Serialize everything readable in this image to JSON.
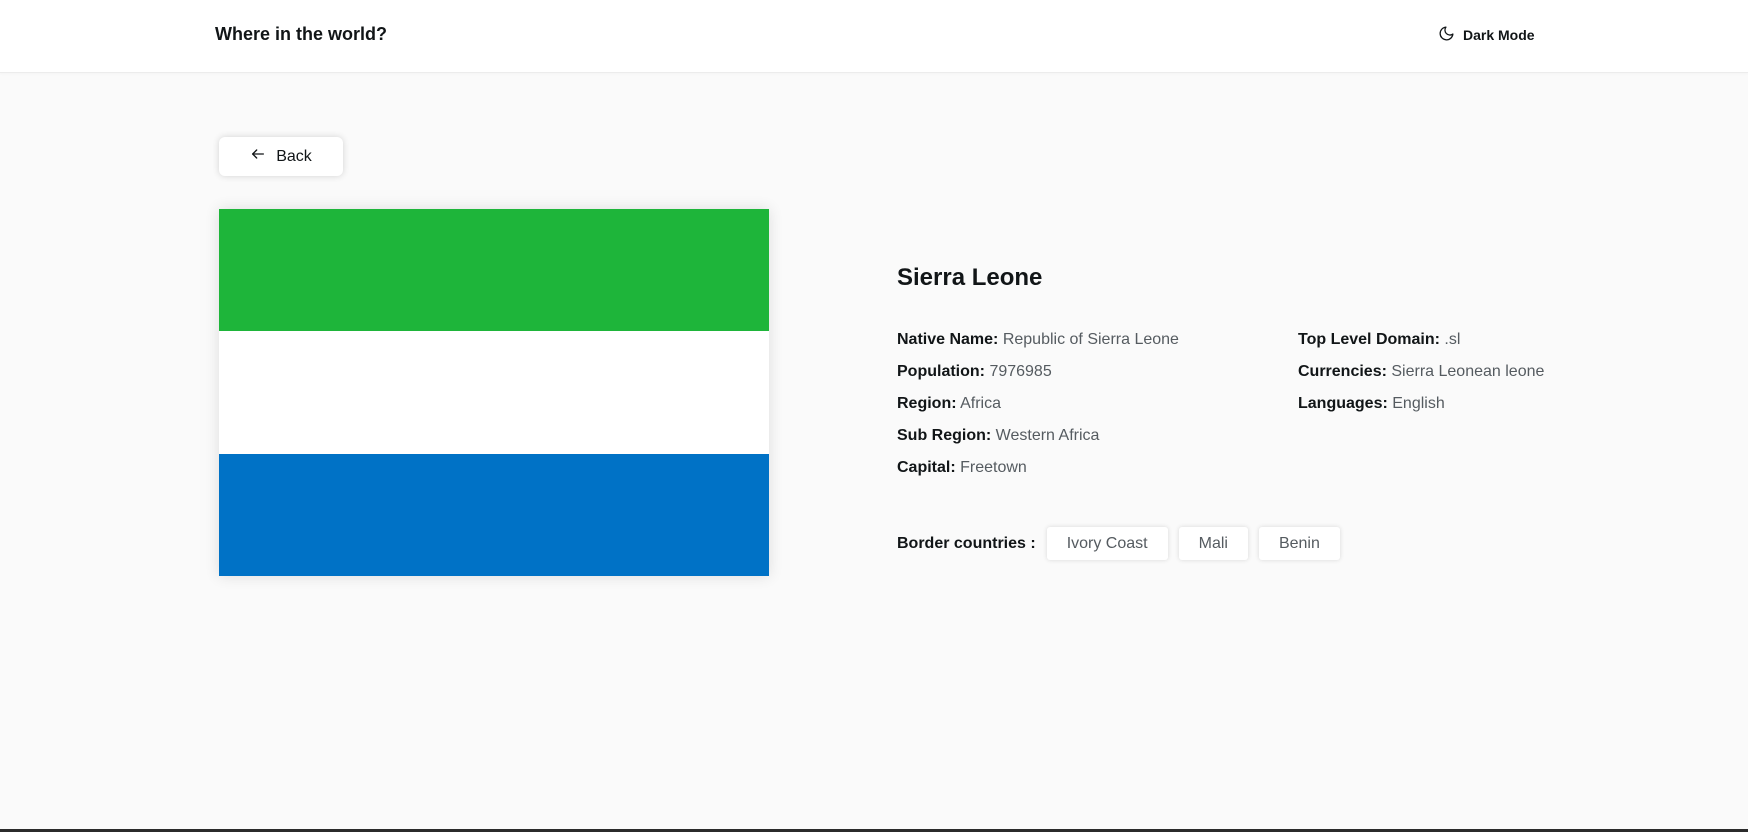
{
  "header": {
    "title": "Where in the world?",
    "theme_toggle_label": "Dark Mode"
  },
  "back_button": {
    "label": "Back"
  },
  "country": {
    "name": "Sierra Leone",
    "flag_colors": [
      "#1eb53a",
      "#ffffff",
      "#0072c6"
    ],
    "details_left": [
      {
        "label": "Native Name:",
        "value": "Republic of Sierra Leone"
      },
      {
        "label": "Population:",
        "value": "7976985"
      },
      {
        "label": "Region:",
        "value": "Africa"
      },
      {
        "label": "Sub Region:",
        "value": "Western Africa"
      },
      {
        "label": "Capital:",
        "value": "Freetown"
      }
    ],
    "details_right": [
      {
        "label": "Top Level Domain:",
        "value": ".sl"
      },
      {
        "label": "Currencies:",
        "value": "Sierra Leonean leone"
      },
      {
        "label": "Languages:",
        "value": "English"
      }
    ],
    "border_label": "Border countries :",
    "borders": [
      "Ivory Coast",
      "Mali",
      "Benin"
    ]
  },
  "colors": {
    "background": "#fafafa",
    "surface": "#ffffff",
    "text_primary": "#111517",
    "text_secondary": "#555b60"
  }
}
